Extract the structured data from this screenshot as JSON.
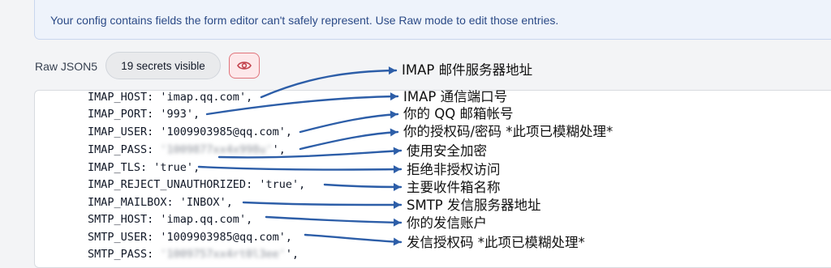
{
  "notice": {
    "text": "Your config contains fields the form editor can't safely represent. Use Raw mode to edit those entries."
  },
  "toolbar": {
    "mode_label": "Raw JSON5",
    "secrets_badge": "19 secrets visible",
    "eye_toggle_icon": "eye-icon"
  },
  "editor": {
    "lines": [
      {
        "key": "IMAP_HOST",
        "value": "'imap.qq.com'",
        "suffix": ","
      },
      {
        "key": "IMAP_PORT",
        "value": "'993'",
        "suffix": ","
      },
      {
        "key": "IMAP_USER",
        "value": "'1009903985@qq.com'",
        "suffix": ","
      },
      {
        "key": "IMAP_PASS",
        "value": "'1009877xx4x998u'",
        "suffix": "',",
        "blurred": true
      },
      {
        "key": "IMAP_TLS",
        "value": "'true'",
        "suffix": ","
      },
      {
        "key": "IMAP_REJECT_UNAUTHORIZED",
        "value": "'true'",
        "suffix": ","
      },
      {
        "key": "IMAP_MAILBOX",
        "value": "'INBOX'",
        "suffix": ","
      },
      {
        "key": "SMTP_HOST",
        "value": "'imap.qq.com'",
        "suffix": ","
      },
      {
        "key": "SMTP_USER",
        "value": "'1009903985@qq.com'",
        "suffix": ","
      },
      {
        "key": "SMTP_PASS",
        "value": "'1009757xx4rt0l3ee'",
        "suffix": "',",
        "blurred": true
      }
    ]
  },
  "annotations": [
    "IMAP 邮件服务器地址",
    "IMAP 通信端口号",
    "你的 QQ 邮箱帐号",
    "你的授权码/密码 *此项已模糊处理*",
    "使用安全加密",
    "拒绝非授权访问",
    "主要收件箱名称",
    "SMTP 发信服务器地址",
    "你的发信账户",
    "发信授权码 *此项已模糊处理*"
  ],
  "colors": {
    "arrow": "#2d5ea8",
    "notice_bg": "#eef3fb",
    "notice_text": "#2b4a86",
    "eye_border": "#e0737a"
  }
}
